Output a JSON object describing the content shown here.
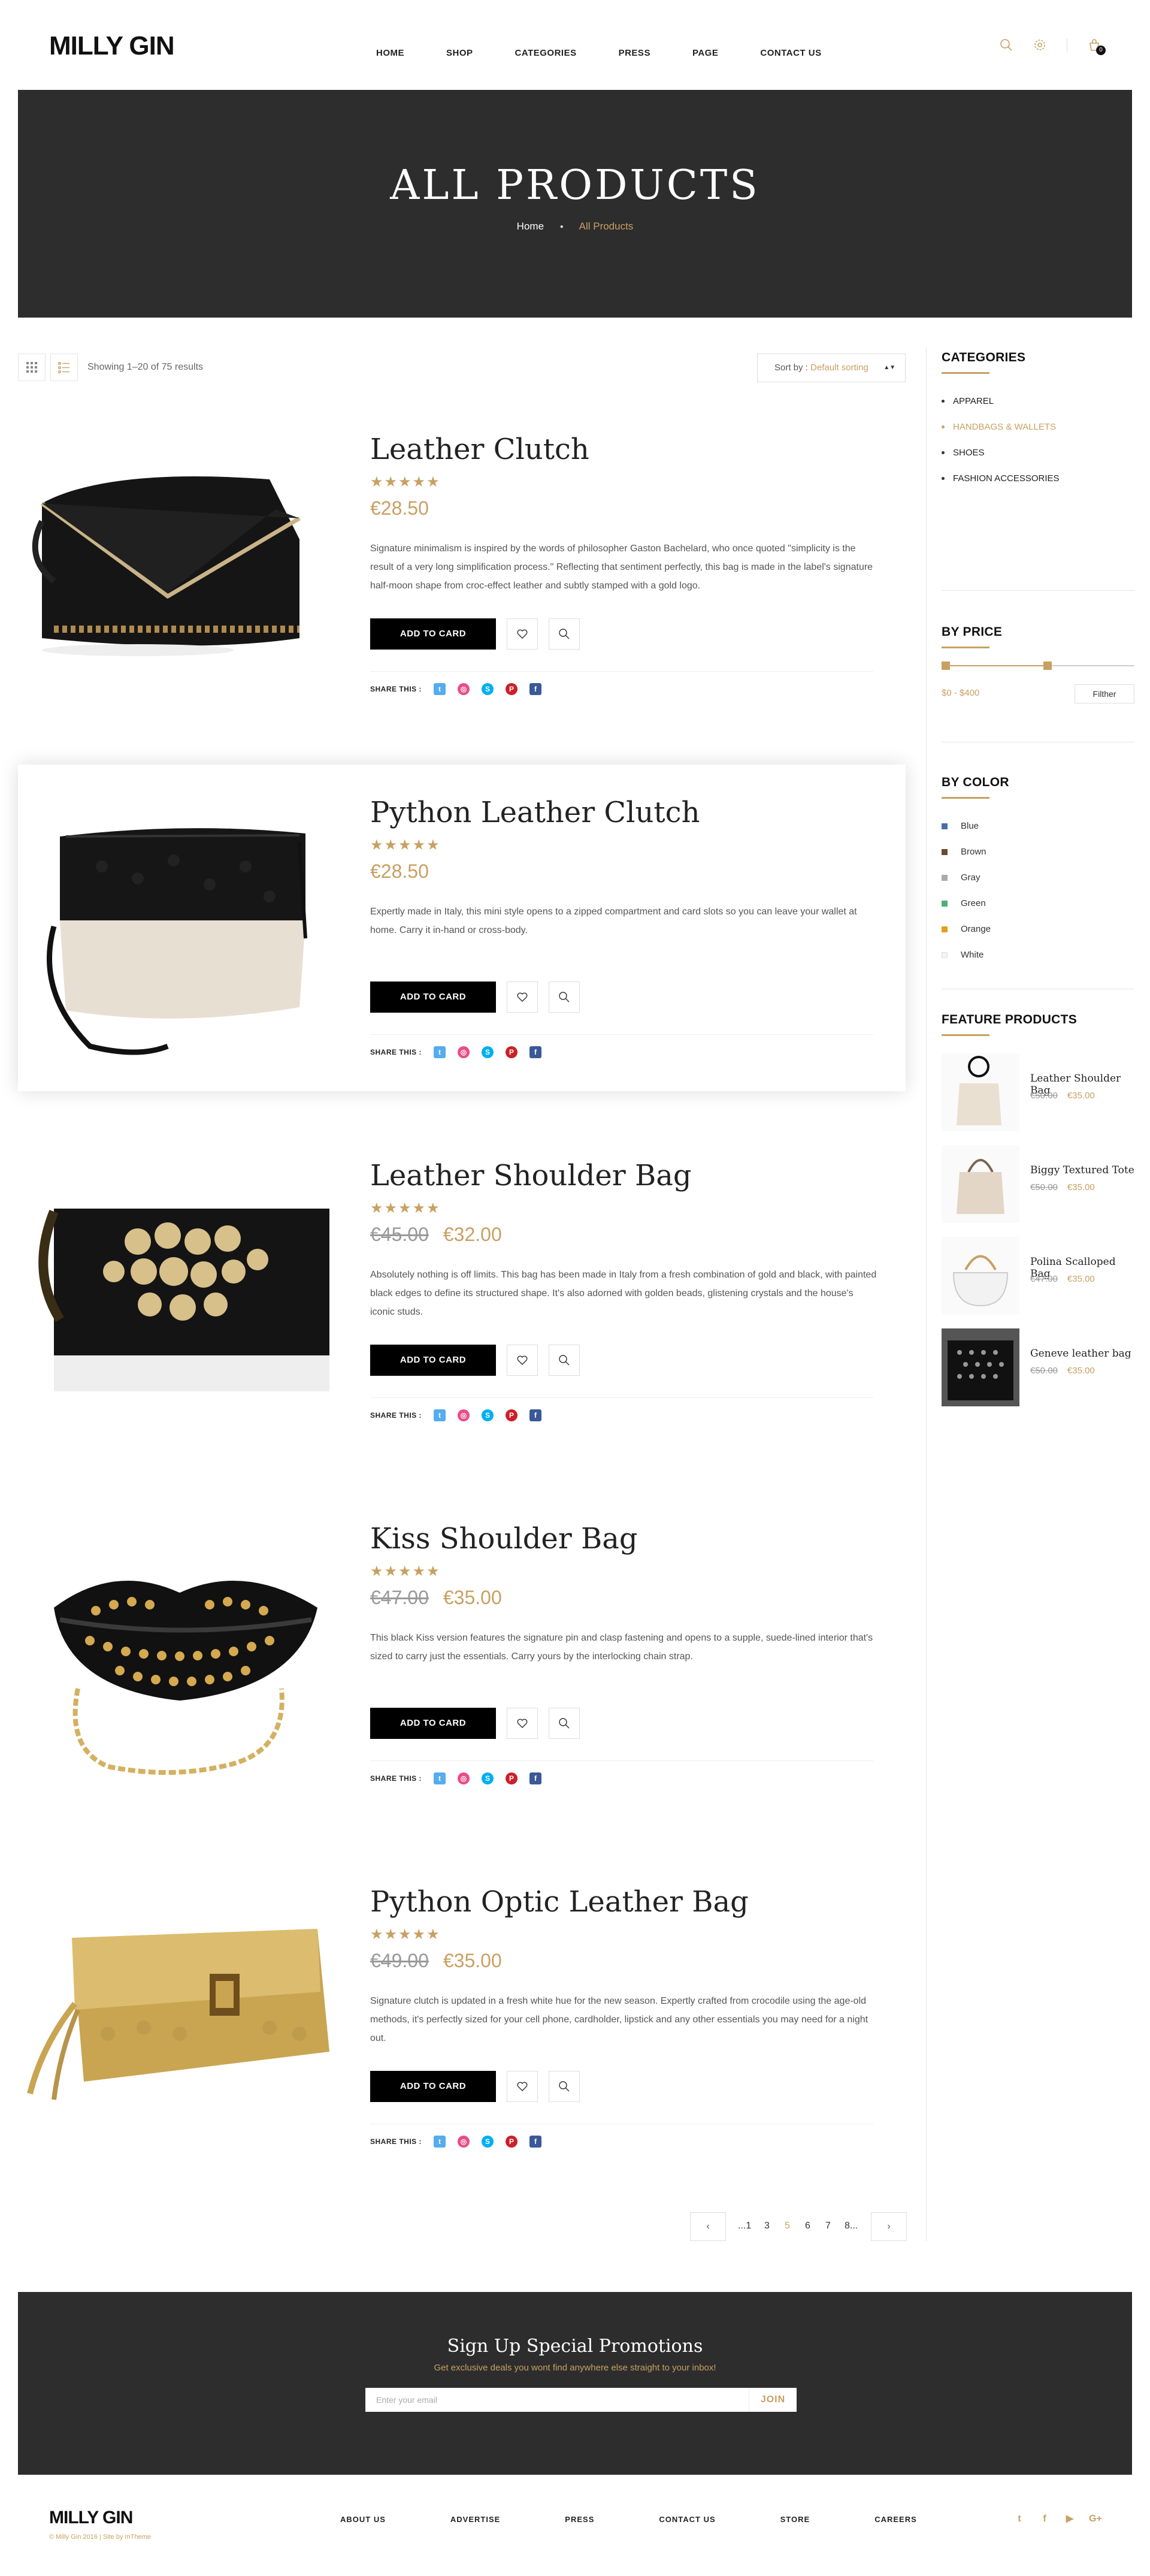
{
  "header": {
    "logo": "MILLY GIN",
    "nav": [
      "HOME",
      "SHOP",
      "CATEGORIES",
      "PRESS",
      "PAGE",
      "CONTACT US"
    ],
    "cart_count": "0",
    "icons": [
      "search-icon",
      "settings-icon",
      "cart-icon"
    ]
  },
  "banner": {
    "title": "ALL PRODUCTS",
    "breadcrumb": {
      "home": "Home",
      "current": "All Products"
    }
  },
  "toolbar": {
    "result_count": "Showing 1–20 of 75 results",
    "sort_label": "Sort by : ",
    "sort_value": "Default sorting"
  },
  "products": [
    {
      "title": "Leather Clutch",
      "rating": 4.5,
      "old_price": "",
      "price": "€28.50",
      "description": "Signature minimalism is inspired by the words of philosopher Gaston Bachelard, who once quoted \"simplicity is the result of a very long simplification process.\" Reflecting that sentiment perfectly, this bag is made in the label's signature half-moon shape from croc-effect leather and subtly stamped with a gold logo.",
      "cart_label": "ADD TO CARD",
      "share_label": "SHARE THIS :"
    },
    {
      "title": "Python Leather Clutch",
      "rating": 4.5,
      "old_price": "",
      "price": "€28.50",
      "description": "Expertly made in Italy, this mini style opens to a zipped compartment and card slots so you can leave your wallet at home. Carry it in-hand or cross-body.",
      "cart_label": "ADD TO CARD",
      "share_label": "SHARE THIS :"
    },
    {
      "title": "Leather Shoulder Bag",
      "rating": 4.5,
      "old_price": "€45.00",
      "price": "€32.00",
      "description": "Absolutely nothing is off limits. This bag has been made in Italy from a fresh combination of gold and black, with painted black edges to define its structured shape. It's also adorned with golden beads, glistening crystals and the house's iconic studs.",
      "cart_label": "ADD TO CARD",
      "share_label": "SHARE THIS :"
    },
    {
      "title": "Kiss Shoulder Bag",
      "rating": 4.5,
      "old_price": "€47.00",
      "price": "€35.00",
      "description": "This black Kiss version features the signature pin and clasp fastening and opens to a supple, suede-lined interior that's sized to carry just the essentials. Carry yours by the interlocking chain strap.",
      "cart_label": "ADD TO CARD",
      "share_label": "SHARE THIS :"
    },
    {
      "title": "Python Optic Leather Bag",
      "rating": 4.5,
      "old_price": "€49.00",
      "price": "€35.00",
      "description": "Signature clutch is updated in a fresh white hue for the new season. Expertly crafted from crocodile using the age-old methods, it's perfectly sized for your cell phone, cardholder, lipstick and any other essentials you may need for a night out.",
      "cart_label": "ADD TO CARD",
      "share_label": "SHARE THIS :"
    }
  ],
  "pagination": {
    "prev": "‹",
    "next": "›",
    "pages": [
      "...1",
      "3",
      "5",
      "6",
      "7",
      "8..."
    ],
    "current": "5"
  },
  "sidebar": {
    "categories_title": "CATEGORIES",
    "categories": [
      "APPAREL",
      "HANDBAGS & WALLETS",
      "SHOES",
      "FASHION ACCESSORIES"
    ],
    "active_category": "HANDBAGS & WALLETS",
    "price_title": "BY PRICE",
    "price_range": "$0 - $400",
    "price_level": 0.55,
    "filter_label": "Filther",
    "color_title": "BY COLOR",
    "colors": [
      {
        "name": "Blue",
        "hex": "#4a6fa5"
      },
      {
        "name": "Brown",
        "hex": "#6b4a2e"
      },
      {
        "name": "Gray",
        "hex": "#aaaaaa"
      },
      {
        "name": "Green",
        "hex": "#4caf7d"
      },
      {
        "name": "Orange",
        "hex": "#e0a020"
      },
      {
        "name": "White",
        "hex": "#f4f4f4"
      }
    ],
    "feature_title": "FEATURE PRODUCTS",
    "features": [
      {
        "name": "Leather Shoulder Bag",
        "old_price": "€50.00",
        "price": "€35.00"
      },
      {
        "name": "Biggy Textured Tote",
        "old_price": "€50.00",
        "price": "€35.00"
      },
      {
        "name": "Polina Scalloped Bag",
        "old_price": "€47.00",
        "price": "€35.00"
      },
      {
        "name": "Geneve leather bag",
        "old_price": "€50.00",
        "price": "€35.00"
      }
    ]
  },
  "newsletter": {
    "title": "Sign Up Special Promotions",
    "subtitle": "Get exclusive deals you wont find anywhere else straight to your inbox!",
    "placeholder": "Enter your email",
    "button": "JOIN"
  },
  "footer": {
    "logo": "MILLY GIN",
    "copyright": "© Milly Gin 2016 | Site by mTheme",
    "nav": [
      "ABOUT US",
      "ADVERTISE",
      "PRESS",
      "CONTACT US",
      "STORE",
      "CAREERS"
    ],
    "social": [
      "twitter-icon",
      "facebook-icon",
      "youtube-icon",
      "google-plus-icon"
    ]
  },
  "colors": {
    "accent": "#c8a062",
    "dark": "#2d2d2d"
  }
}
